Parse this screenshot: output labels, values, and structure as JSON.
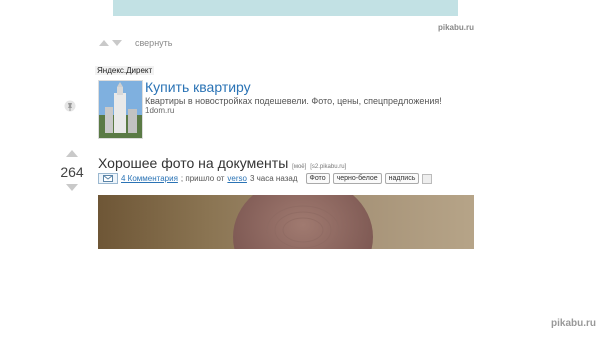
{
  "watermark_top": "pikabu.ru",
  "watermark_bottom": "pikabu.ru",
  "prev_post": {
    "collapse_label": "свернуть"
  },
  "ad": {
    "provider_label": "Яндекс.Директ",
    "title": "Купить квартиру",
    "text": "Квартиры в новостройках подешевели. Фото, цены, спецпредложения!",
    "domain": "1dom.ru"
  },
  "post": {
    "rating": "264",
    "title": "Хорошее фото на документы",
    "title_tag_mine": "[моё]",
    "title_source": "[s2.pikabu.ru]",
    "comments_link": "4 Комментария",
    "posted_text": "; пришло от",
    "author": "verso",
    "time_ago": "3 часа назад",
    "tags": [
      "Фото",
      "черно-белое",
      "надпись"
    ]
  }
}
